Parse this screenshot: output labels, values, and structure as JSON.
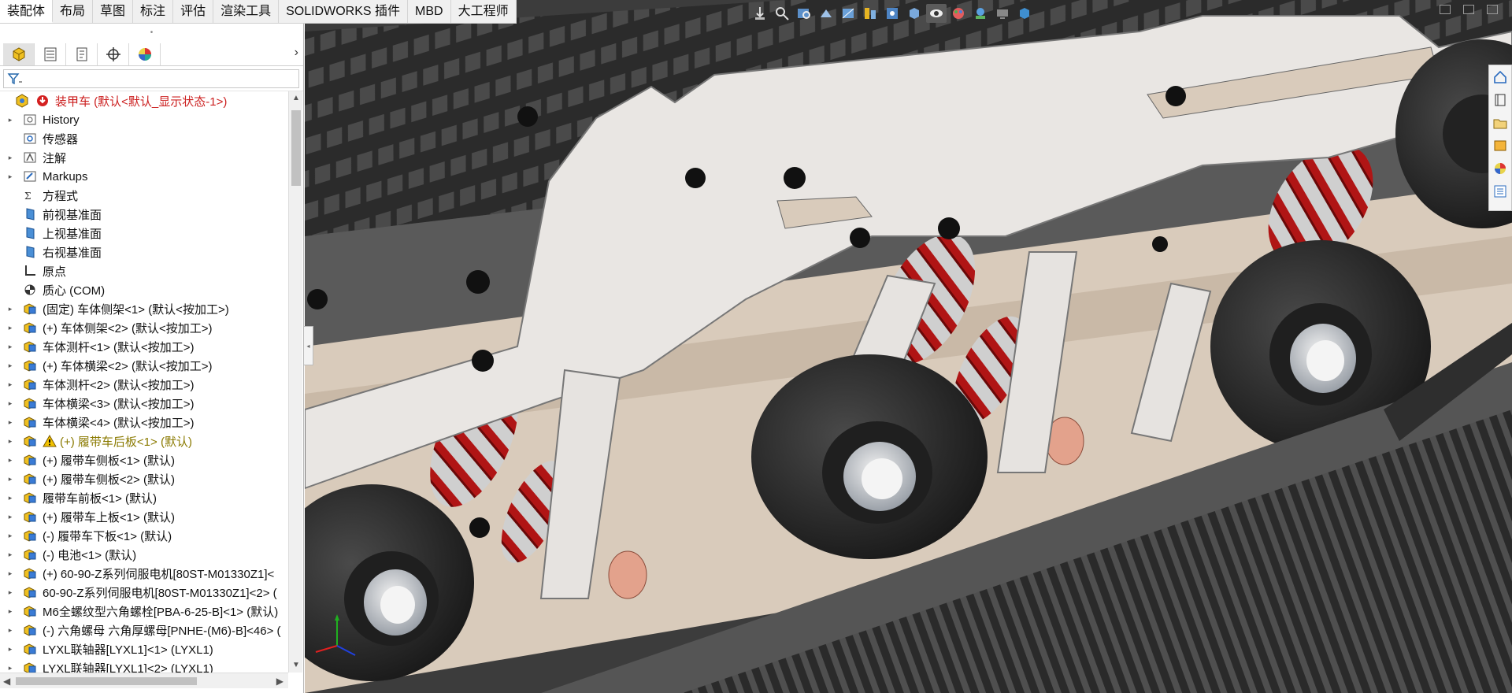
{
  "command_tabs": [
    "装配体",
    "布局",
    "草图",
    "标注",
    "评估",
    "渲染工具",
    "SOLIDWORKS 插件",
    "MBD",
    "大工程师"
  ],
  "panel": {
    "tabs": [
      "featuremanager-icon",
      "propertymanager-icon",
      "configurationmanager-icon",
      "dimxpertmanager-icon",
      "displaymanager-icon"
    ],
    "expand_arrow": "›",
    "filter_icon": "filter-icon"
  },
  "tree": {
    "root": "装甲车  (默认<默认_显示状态-1>)",
    "items": [
      {
        "label": "History",
        "icon": "history-icon",
        "expandable": true
      },
      {
        "label": "传感器",
        "icon": "sensor-icon",
        "expandable": false
      },
      {
        "label": "注解",
        "icon": "annotation-icon",
        "expandable": true
      },
      {
        "label": "Markups",
        "icon": "markup-icon",
        "expandable": true
      },
      {
        "label": "方程式",
        "icon": "equation-icon",
        "expandable": false
      },
      {
        "label": "前视基准面",
        "icon": "plane-icon",
        "expandable": false
      },
      {
        "label": "上视基准面",
        "icon": "plane-icon",
        "expandable": false
      },
      {
        "label": "右视基准面",
        "icon": "plane-icon",
        "expandable": false
      },
      {
        "label": "原点",
        "icon": "origin-icon",
        "expandable": false
      },
      {
        "label": "质心 (COM)",
        "icon": "center-of-mass-icon",
        "expandable": false
      },
      {
        "label": "(固定) 车体侧架<1> (默认<按加工>)",
        "icon": "part-icon",
        "expandable": true
      },
      {
        "label": "(+) 车体侧架<2> (默认<按加工>)",
        "icon": "part-icon",
        "expandable": true
      },
      {
        "label": "车体测杆<1> (默认<按加工>)",
        "icon": "part-icon",
        "expandable": true
      },
      {
        "label": "(+) 车体横梁<2> (默认<按加工>)",
        "icon": "part-icon",
        "expandable": true
      },
      {
        "label": "车体测杆<2> (默认<按加工>)",
        "icon": "part-icon",
        "expandable": true
      },
      {
        "label": "车体横梁<3> (默认<按加工>)",
        "icon": "part-icon",
        "expandable": true
      },
      {
        "label": "车体横梁<4> (默认<按加工>)",
        "icon": "part-icon",
        "expandable": true
      },
      {
        "label": "(+) 履带车后板<1> (默认)",
        "icon": "part-icon",
        "expandable": true,
        "warning": true
      },
      {
        "label": "(+) 履带车侧板<1> (默认)",
        "icon": "part-icon",
        "expandable": true
      },
      {
        "label": "(+) 履带车侧板<2> (默认)",
        "icon": "part-icon",
        "expandable": true
      },
      {
        "label": "履带车前板<1> (默认)",
        "icon": "part-icon",
        "expandable": true
      },
      {
        "label": "(+) 履带车上板<1> (默认)",
        "icon": "part-icon",
        "expandable": true
      },
      {
        "label": "(-) 履带车下板<1> (默认)",
        "icon": "part-icon",
        "expandable": true
      },
      {
        "label": "(-) 电池<1> (默认)",
        "icon": "part-icon",
        "expandable": true
      },
      {
        "label": "(+) 60-90-Z系列伺服电机[80ST-M01330Z1]<",
        "icon": "part-icon",
        "expandable": true
      },
      {
        "label": "60-90-Z系列伺服电机[80ST-M01330Z1]<2> (",
        "icon": "part-icon",
        "expandable": true
      },
      {
        "label": "M6全螺纹型六角螺栓[PBA-6-25-B]<1> (默认)",
        "icon": "part-icon",
        "expandable": true
      },
      {
        "label": "(-) 六角螺母 六角厚螺母[PNHE-(M6)-B]<46> (",
        "icon": "part-icon",
        "expandable": true
      },
      {
        "label": "LYXL联轴器[LYXL1]<1> (LYXL1)",
        "icon": "part-icon",
        "expandable": true
      },
      {
        "label": "LYXL联轴器[LYXL1]<2> (LYXL1)",
        "icon": "part-icon",
        "expandable": true
      }
    ]
  },
  "heads_up_toolbar": [
    "view-orientation-icon",
    "zoom-to-fit-icon",
    "zoom-area-icon",
    "previous-view-icon",
    "section-view-icon",
    "dynamic-annotation-icon",
    "view-settings-icon",
    "display-style-icon",
    "hide-show-icon",
    "edit-appearance-icon",
    "apply-scene-icon",
    "view-settings-icon-2",
    "display-pane-icon"
  ],
  "task_pane": [
    "home-icon",
    "design-library-icon",
    "file-explorer-icon",
    "view-palette-icon",
    "appearances-icon",
    "custom-properties-icon"
  ],
  "colors": {
    "selection_accent": "#cc1f1f",
    "warning": "#e0b000",
    "spring_red": "#b01515",
    "plate": "#e9e6e3",
    "wheel": "#2a2a2a"
  }
}
